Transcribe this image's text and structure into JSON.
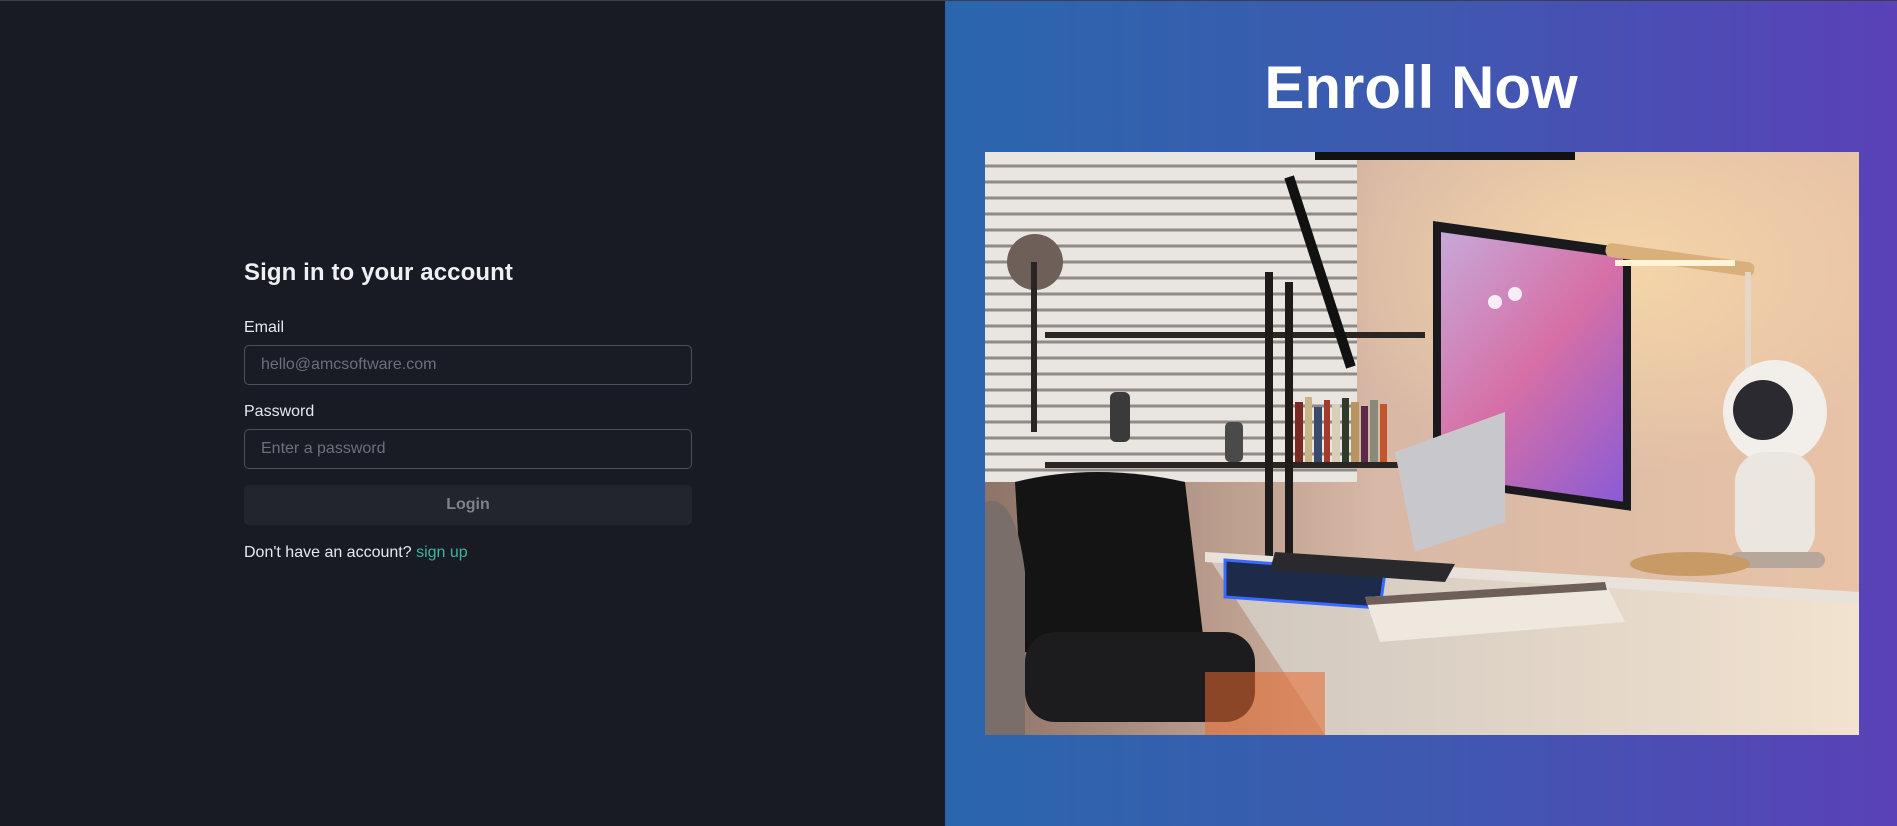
{
  "login": {
    "title": "Sign in to your account",
    "email_label": "Email",
    "email_placeholder": "hello@amcsoftware.com",
    "password_label": "Password",
    "password_placeholder": "Enter a password",
    "login_label": "Login",
    "signup_prompt": "Don't have an account?",
    "signup_link": "sign up"
  },
  "promo": {
    "title": "Enroll Now"
  },
  "colors": {
    "left_bg": "#181b23",
    "accent_link": "#3fb39a",
    "gradient_start": "#2a66ad",
    "gradient_end": "#5a41b8"
  }
}
